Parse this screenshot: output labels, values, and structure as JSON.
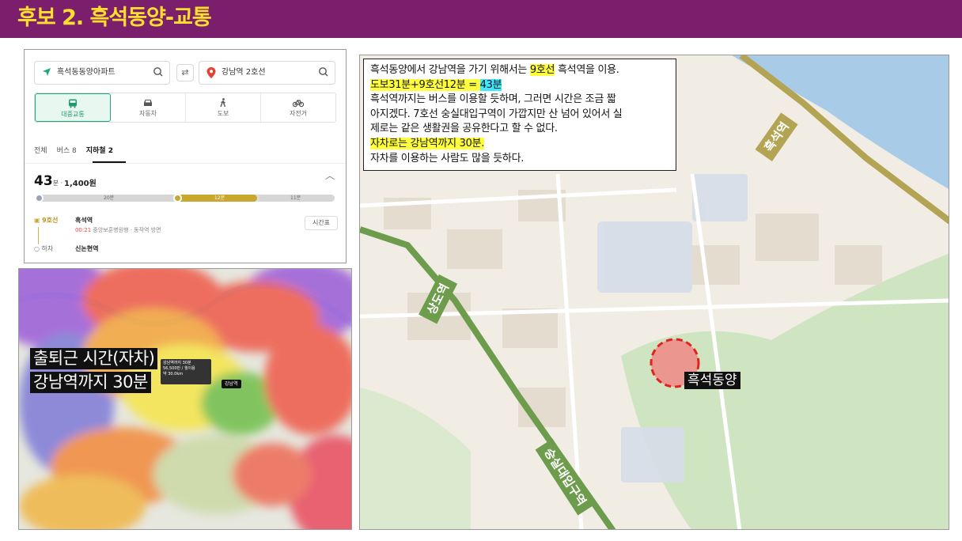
{
  "header": {
    "title": "후보 2. 흑석동양-교통"
  },
  "route": {
    "origin": "흑석동동양아파트",
    "destination": "강남역 2호선",
    "modes": [
      {
        "label": "대중교통",
        "icon": "bus-icon",
        "active": true
      },
      {
        "label": "자동차",
        "icon": "car-icon",
        "active": false
      },
      {
        "label": "도보",
        "icon": "walk-icon",
        "active": false
      },
      {
        "label": "자전거",
        "icon": "bicycle-icon",
        "active": false
      }
    ],
    "filters": [
      "전체",
      "버스 8",
      "지하철 2"
    ],
    "duration": "43",
    "duration_unit": "분 ·",
    "fare": "1,400원",
    "segments": [
      "20분",
      "12분",
      "11분"
    ],
    "line_badge": "9호선",
    "board_station": "흑석역",
    "board_time": "00:21",
    "board_detail": "중앙보훈병원행 · 동작역 방면",
    "timetable_label": "시간표",
    "alight_label": "하차",
    "alight_station": "신논현역",
    "colors": {
      "accent": "#1fa879",
      "line9": "#bda13a"
    }
  },
  "heatmap": {
    "caption_line1": "출퇴근 시간(자차)",
    "caption_line2": "강남역까지 30분",
    "popup_line1": "강남역까지 30분",
    "popup_line2": "56,500만 / 월이용",
    "popup_line3": "약 30.0km",
    "tag": "강남역"
  },
  "areamap": {
    "note_line1_a": "흑석동양에서 강남역을 가기 위해서는 ",
    "note_line1_hl": "9호선",
    "note_line1_b": " 흑석역을 이용.",
    "note_line2_a": "도보31분+9호선12분 = ",
    "note_line2_hl": "43분",
    "note_line3": "흑석역까지는 버스를 이용할 듯하며, 그러면 시간은 조금 짧",
    "note_line4": "아지겠다. 7호선 숭실대입구역이 가깝지만 산 넘어 있어서 실",
    "note_line5": "제로는 같은 생활권을 공유한다고 할 수 없다.",
    "note_line6": "자차로는 강남역까지 30분.",
    "note_line7": "자차를 이용하는 사람도 많을 듯하다.",
    "site_label": "흑석동양",
    "station_1": "흑석역",
    "station_2": "상도역",
    "station_3": "숭실대입구역",
    "colors": {
      "line9": "#b3a453",
      "line7": "#6c9c4c",
      "river": "#a8cbe8",
      "site": "#e0231f"
    }
  }
}
